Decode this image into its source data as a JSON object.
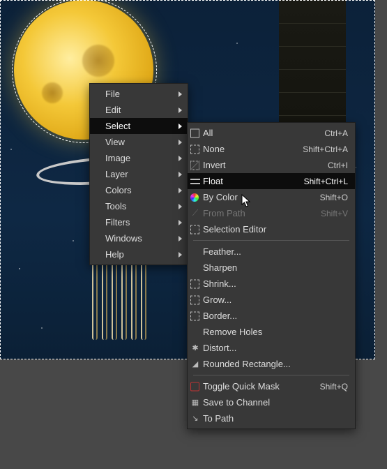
{
  "main_menu": {
    "items": [
      {
        "label": "File",
        "submenu": true
      },
      {
        "label": "Edit",
        "submenu": true
      },
      {
        "label": "Select",
        "submenu": true,
        "highlight": true
      },
      {
        "label": "View",
        "submenu": true
      },
      {
        "label": "Image",
        "submenu": true
      },
      {
        "label": "Layer",
        "submenu": true
      },
      {
        "label": "Colors",
        "submenu": true
      },
      {
        "label": "Tools",
        "submenu": true
      },
      {
        "label": "Filters",
        "submenu": true
      },
      {
        "label": "Windows",
        "submenu": true
      },
      {
        "label": "Help",
        "submenu": true
      }
    ]
  },
  "select_menu": {
    "items": [
      {
        "label": "All",
        "accel": "Ctrl+A"
      },
      {
        "label": "None",
        "accel": "Shift+Ctrl+A"
      },
      {
        "label": "Invert",
        "accel": "Ctrl+I"
      },
      {
        "label": "Float",
        "accel": "Shift+Ctrl+L",
        "highlight": true
      },
      {
        "label": "By Color",
        "accel": "Shift+O"
      },
      {
        "label": "From Path",
        "accel": "Shift+V",
        "disabled": true
      },
      {
        "label": "Selection Editor"
      }
    ],
    "items2": [
      {
        "label": "Feather..."
      },
      {
        "label": "Sharpen"
      },
      {
        "label": "Shrink..."
      },
      {
        "label": "Grow..."
      },
      {
        "label": "Border..."
      },
      {
        "label": "Remove Holes"
      },
      {
        "label": "Distort..."
      },
      {
        "label": "Rounded Rectangle..."
      }
    ],
    "items3": [
      {
        "label": "Toggle Quick Mask",
        "accel": "Shift+Q"
      },
      {
        "label": "Save to Channel"
      },
      {
        "label": "To Path"
      }
    ]
  }
}
